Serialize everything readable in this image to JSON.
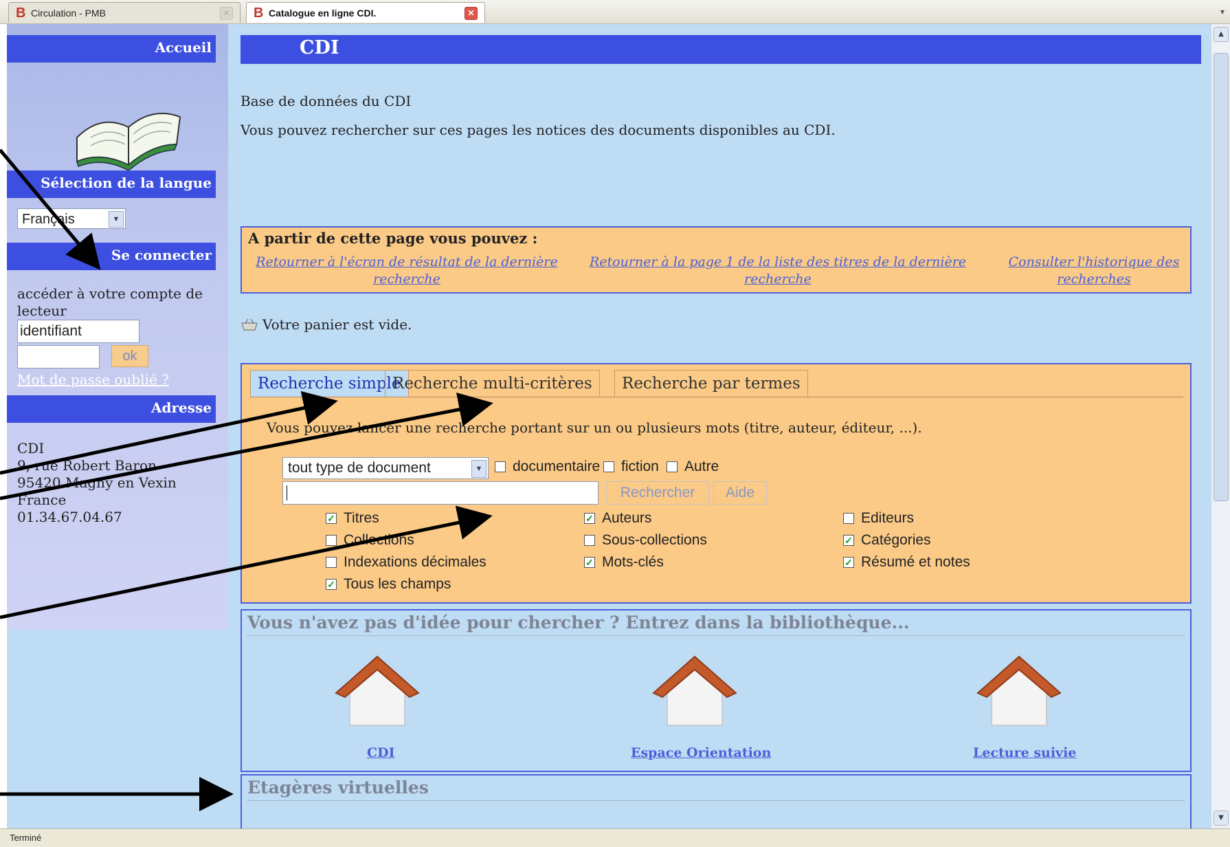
{
  "browser": {
    "tabs": [
      {
        "label": "Circulation - PMB"
      },
      {
        "label": "Catalogue en ligne CDI."
      }
    ],
    "status": "Terminé"
  },
  "sidebar": {
    "home_label": "Accueil",
    "lang_heading": "Sélection de la langue",
    "lang_selected": "Français",
    "login_heading": "Se connecter",
    "login_text": "accéder à votre compte de lecteur",
    "login_placeholder": "identifiant",
    "ok_label": "ok",
    "forgot_label": "Mot de passe oublié ?",
    "address_heading": "Adresse",
    "address_lines": [
      "CDI",
      "9, rue Robert Baron",
      "95420 Magny en Vexin",
      "France",
      "01.34.67.04.67"
    ]
  },
  "main": {
    "title": "CDI",
    "intro_1": "Base de données du CDI",
    "intro_2": "Vous pouvez rechercher sur ces pages les notices des documents disponibles au CDI.",
    "from_page": {
      "title": "A partir de cette page vous pouvez :",
      "links": [
        {
          "line1": "Retourner à l'écran de résultat de la dernière",
          "line2": "recherche"
        },
        {
          "line1": "Retourner à la page 1 de la liste des titres de la dernière",
          "line2": "recherche"
        },
        {
          "line1": "Consulter l'historique des",
          "line2": "recherches"
        }
      ]
    },
    "basket": "Votre panier est vide.",
    "search": {
      "tabs": [
        "Recherche simple",
        "Recherche multi-critères",
        "Recherche par termes"
      ],
      "description": "Vous pouvez lancer une recherche portant sur un ou plusieurs mots (titre, auteur, éditeur, ...).",
      "doc_type": "tout type de document",
      "type_filters": [
        {
          "label": "documentaire",
          "checked": false
        },
        {
          "label": "fiction",
          "checked": false
        },
        {
          "label": "Autre",
          "checked": false
        }
      ],
      "search_button": "Rechercher",
      "help_button": "Aide",
      "fields": [
        {
          "label": "Titres",
          "checked": true
        },
        {
          "label": "Auteurs",
          "checked": true
        },
        {
          "label": "Editeurs",
          "checked": false
        },
        {
          "label": "Collections",
          "checked": false
        },
        {
          "label": "Sous-collections",
          "checked": false
        },
        {
          "label": "Catégories",
          "checked": true
        },
        {
          "label": "Indexations décimales",
          "checked": false
        },
        {
          "label": "Mots-clés",
          "checked": true
        },
        {
          "label": "Résumé et notes",
          "checked": true
        },
        {
          "label": "Tous les champs",
          "checked": true
        }
      ]
    },
    "library": {
      "title": "Vous n'avez pas d'idée pour chercher ? Entrez dans la bibliothèque...",
      "rooms": [
        "CDI",
        "Espace Orientation",
        "Lecture suivie"
      ]
    },
    "shelves_title": "Etagères virtuelles"
  }
}
